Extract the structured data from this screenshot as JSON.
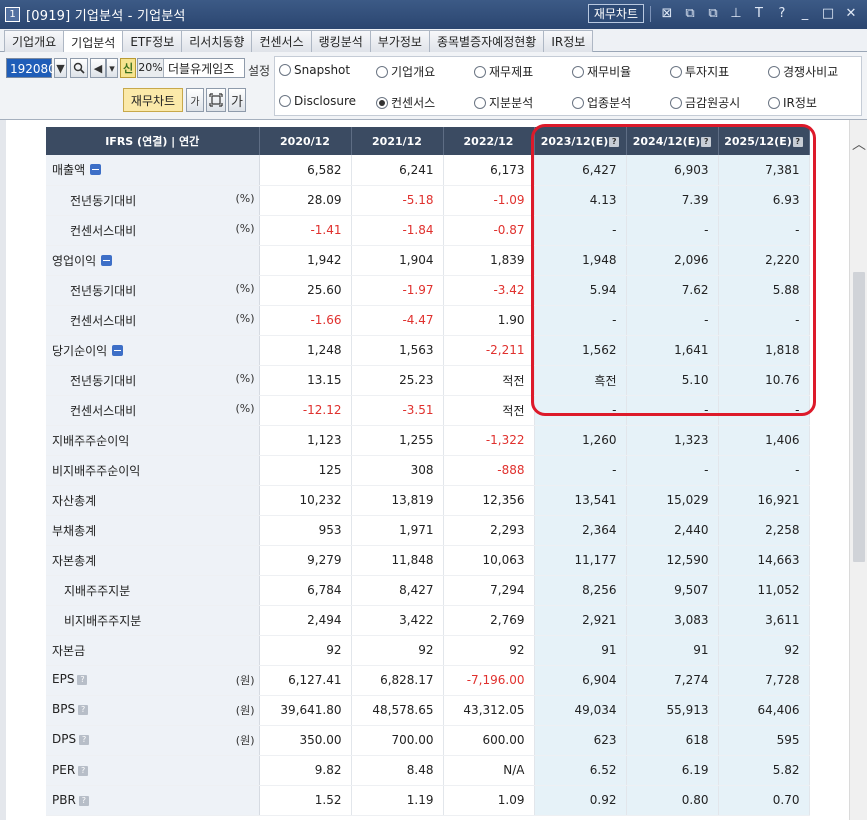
{
  "titlebar": {
    "num": "1",
    "title": "[0919] 기업분석 - 기업분석",
    "fin_chart_btn": "재무차트",
    "icons": [
      "chart-icon",
      "window-icon",
      "copy-icon",
      "pin-icon",
      "font-icon",
      "help-icon",
      "minimize-icon",
      "maximize-icon",
      "close-icon"
    ],
    "icon_glyphs": [
      "⊠",
      "⧉",
      "⧉",
      "⊥",
      "T",
      "?",
      "_",
      "□",
      "✕"
    ]
  },
  "menu": {
    "tabs": [
      "기업개요",
      "기업분석",
      "ETF정보",
      "리서치동향",
      "컨센서스",
      "랭킹분석",
      "부가정보",
      "종목별증자예정현황",
      "IR정보"
    ],
    "active": 1
  },
  "toolbar": {
    "code": "192080",
    "btn_sin": "신",
    "name_pct": "20%",
    "name": "더블유게임즈",
    "setting": "설정",
    "fin_chart": "재무차트",
    "font_btn": "가",
    "font_btn2": "가"
  },
  "radios": [
    {
      "label": "Snapshot",
      "on": false
    },
    {
      "label": "기업개요",
      "on": false
    },
    {
      "label": "재무제표",
      "on": false
    },
    {
      "label": "재무비율",
      "on": false
    },
    {
      "label": "투자지표",
      "on": false
    },
    {
      "label": "경쟁사비교",
      "on": false
    },
    {
      "label": "Disclosure",
      "on": false
    },
    {
      "label": "컨센서스",
      "on": true
    },
    {
      "label": "지분분석",
      "on": false
    },
    {
      "label": "업종분석",
      "on": false
    },
    {
      "label": "금감원공시",
      "on": false
    },
    {
      "label": "IR정보",
      "on": false
    }
  ],
  "table": {
    "header": {
      "label": "IFRS (연결) | 연간",
      "cols": [
        "2020/12",
        "2021/12",
        "2022/12",
        "2023/12(E)",
        "2024/12(E)",
        "2025/12(E)"
      ],
      "est_help": "?"
    },
    "rows": [
      {
        "label": "매출액",
        "indent": 0,
        "unit": "",
        "icon": "minus",
        "values": [
          "6,582",
          "6,241",
          "6,173",
          "6,427",
          "6,903",
          "7,381"
        ],
        "neg": [
          false,
          false,
          false,
          false,
          false,
          false
        ]
      },
      {
        "label": "전년동기대비",
        "indent": 1,
        "unit": "(%)",
        "icon": "",
        "values": [
          "28.09",
          "-5.18",
          "-1.09",
          "4.13",
          "7.39",
          "6.93"
        ],
        "neg": [
          false,
          true,
          true,
          false,
          false,
          false
        ]
      },
      {
        "label": "컨센서스대비",
        "indent": 1,
        "unit": "(%)",
        "icon": "",
        "values": [
          "-1.41",
          "-1.84",
          "-0.87",
          "-",
          "-",
          "-"
        ],
        "neg": [
          true,
          true,
          true,
          false,
          false,
          false
        ]
      },
      {
        "label": "영업이익",
        "indent": 0,
        "unit": "",
        "icon": "minus",
        "values": [
          "1,942",
          "1,904",
          "1,839",
          "1,948",
          "2,096",
          "2,220"
        ],
        "neg": [
          false,
          false,
          false,
          false,
          false,
          false
        ]
      },
      {
        "label": "전년동기대비",
        "indent": 1,
        "unit": "(%)",
        "icon": "",
        "values": [
          "25.60",
          "-1.97",
          "-3.42",
          "5.94",
          "7.62",
          "5.88"
        ],
        "neg": [
          false,
          true,
          true,
          false,
          false,
          false
        ]
      },
      {
        "label": "컨센서스대비",
        "indent": 1,
        "unit": "(%)",
        "icon": "",
        "values": [
          "-1.66",
          "-4.47",
          "1.90",
          "-",
          "-",
          "-"
        ],
        "neg": [
          true,
          true,
          false,
          false,
          false,
          false
        ]
      },
      {
        "label": "당기순이익",
        "indent": 0,
        "unit": "",
        "icon": "minus",
        "values": [
          "1,248",
          "1,563",
          "-2,211",
          "1,562",
          "1,641",
          "1,818"
        ],
        "neg": [
          false,
          false,
          true,
          false,
          false,
          false
        ]
      },
      {
        "label": "전년동기대비",
        "indent": 1,
        "unit": "(%)",
        "icon": "",
        "values": [
          "13.15",
          "25.23",
          "적전",
          "흑전",
          "5.10",
          "10.76"
        ],
        "neg": [
          false,
          false,
          false,
          false,
          false,
          false
        ]
      },
      {
        "label": "컨센서스대비",
        "indent": 1,
        "unit": "(%)",
        "icon": "",
        "values": [
          "-12.12",
          "-3.51",
          "적전",
          "-",
          "-",
          "-"
        ],
        "neg": [
          true,
          true,
          false,
          false,
          false,
          false
        ]
      },
      {
        "label": "지배주주순이익",
        "indent": 0,
        "unit": "",
        "icon": "",
        "values": [
          "1,123",
          "1,255",
          "-1,322",
          "1,260",
          "1,323",
          "1,406"
        ],
        "neg": [
          false,
          false,
          true,
          false,
          false,
          false
        ]
      },
      {
        "label": "비지배주주순이익",
        "indent": 0,
        "unit": "",
        "icon": "",
        "values": [
          "125",
          "308",
          "-888",
          "-",
          "-",
          "-"
        ],
        "neg": [
          false,
          false,
          true,
          false,
          false,
          false
        ]
      },
      {
        "label": "자산총계",
        "indent": 0,
        "unit": "",
        "icon": "",
        "values": [
          "10,232",
          "13,819",
          "12,356",
          "13,541",
          "15,029",
          "16,921"
        ],
        "neg": [
          false,
          false,
          false,
          false,
          false,
          false
        ]
      },
      {
        "label": "부채총계",
        "indent": 0,
        "unit": "",
        "icon": "",
        "values": [
          "953",
          "1,971",
          "2,293",
          "2,364",
          "2,440",
          "2,258"
        ],
        "neg": [
          false,
          false,
          false,
          false,
          false,
          false
        ]
      },
      {
        "label": "자본총계",
        "indent": 0,
        "unit": "",
        "icon": "",
        "values": [
          "9,279",
          "11,848",
          "10,063",
          "11,177",
          "12,590",
          "14,663"
        ],
        "neg": [
          false,
          false,
          false,
          false,
          false,
          false
        ]
      },
      {
        "label": "지배주주지분",
        "indent": 2,
        "unit": "",
        "icon": "",
        "values": [
          "6,784",
          "8,427",
          "7,294",
          "8,256",
          "9,507",
          "11,052"
        ],
        "neg": [
          false,
          false,
          false,
          false,
          false,
          false
        ]
      },
      {
        "label": "비지배주주지분",
        "indent": 2,
        "unit": "",
        "icon": "",
        "values": [
          "2,494",
          "3,422",
          "2,769",
          "2,921",
          "3,083",
          "3,611"
        ],
        "neg": [
          false,
          false,
          false,
          false,
          false,
          false
        ]
      },
      {
        "label": "자본금",
        "indent": 0,
        "unit": "",
        "icon": "",
        "values": [
          "92",
          "92",
          "92",
          "91",
          "91",
          "92"
        ],
        "neg": [
          false,
          false,
          false,
          false,
          false,
          false
        ]
      },
      {
        "label": "EPS",
        "indent": 0,
        "unit": "(원)",
        "icon": "help",
        "values": [
          "6,127.41",
          "6,828.17",
          "-7,196.00",
          "6,904",
          "7,274",
          "7,728"
        ],
        "neg": [
          false,
          false,
          true,
          false,
          false,
          false
        ]
      },
      {
        "label": "BPS",
        "indent": 0,
        "unit": "(원)",
        "icon": "help",
        "values": [
          "39,641.80",
          "48,578.65",
          "43,312.05",
          "49,034",
          "55,913",
          "64,406"
        ],
        "neg": [
          false,
          false,
          false,
          false,
          false,
          false
        ]
      },
      {
        "label": "DPS",
        "indent": 0,
        "unit": "(원)",
        "icon": "help",
        "values": [
          "350.00",
          "700.00",
          "600.00",
          "623",
          "618",
          "595"
        ],
        "neg": [
          false,
          false,
          false,
          false,
          false,
          false
        ]
      },
      {
        "label": "PER",
        "indent": 0,
        "unit": "",
        "icon": "help",
        "values": [
          "9.82",
          "8.48",
          "N/A",
          "6.52",
          "6.19",
          "5.82"
        ],
        "neg": [
          false,
          false,
          false,
          false,
          false,
          false
        ]
      },
      {
        "label": "PBR",
        "indent": 0,
        "unit": "",
        "icon": "help",
        "values": [
          "1.52",
          "1.19",
          "1.09",
          "0.92",
          "0.80",
          "0.70"
        ],
        "neg": [
          false,
          false,
          false,
          false,
          false,
          false
        ]
      }
    ]
  },
  "colors": {
    "header_bg": "#3b4b62",
    "estimate_bg": "#e6f2f8",
    "negative": "#e0312e",
    "highlight": "#dd1a2a"
  }
}
